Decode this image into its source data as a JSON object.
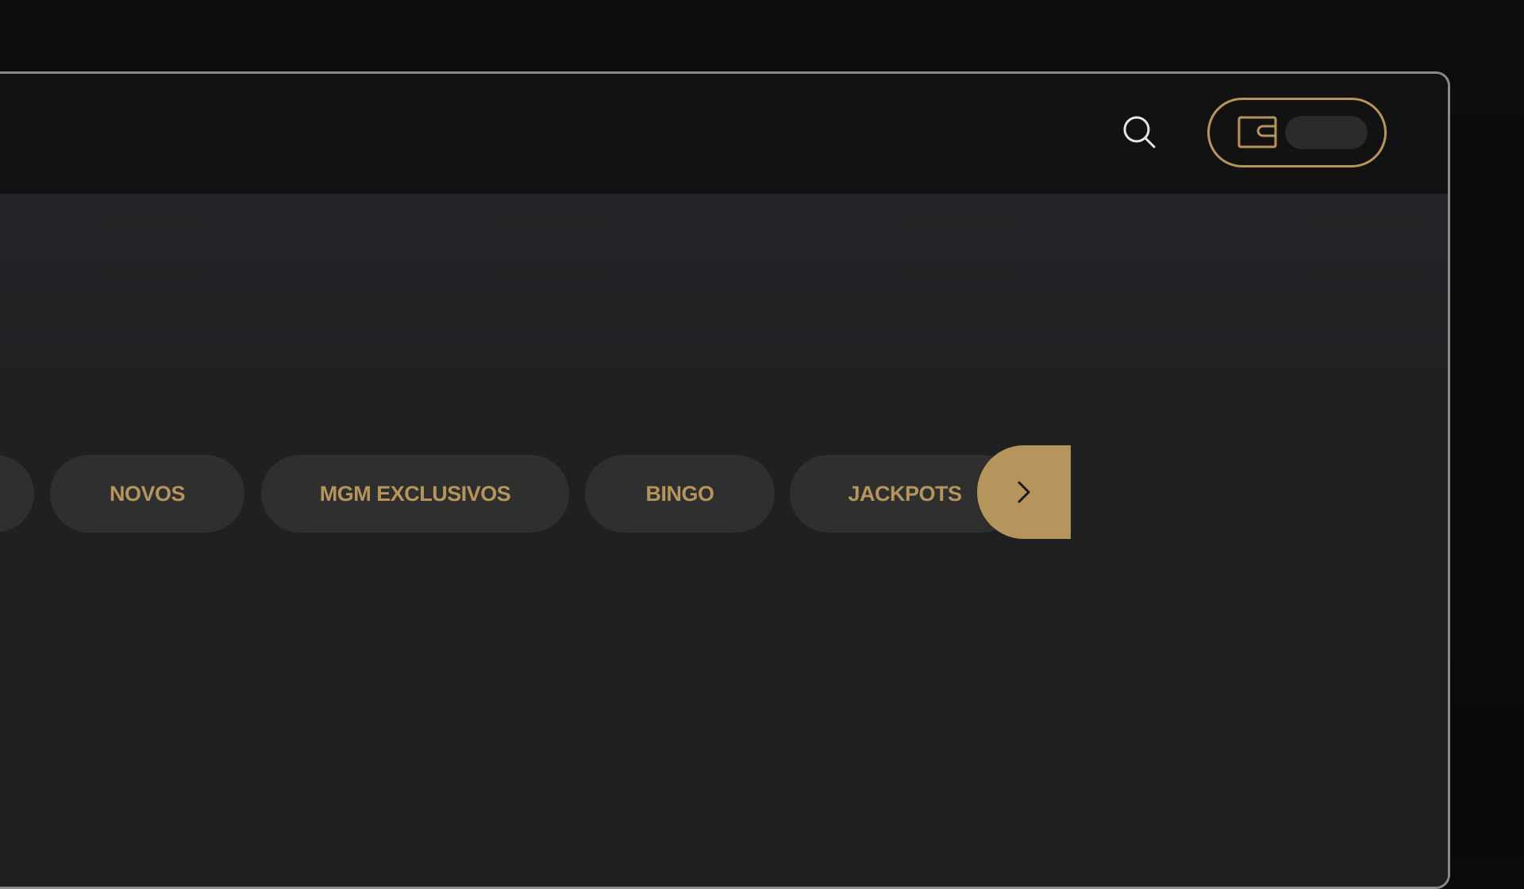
{
  "header": {
    "search_icon": "search-icon",
    "wallet_icon": "wallet-icon",
    "accent_color": "#b5955b"
  },
  "categories": {
    "items": [
      {
        "label": ""
      },
      {
        "label": "NOVOS"
      },
      {
        "label": "MGM EXCLUSIVOS"
      },
      {
        "label": "BINGO"
      },
      {
        "label": "JACKPOTS"
      }
    ],
    "next_icon": "chevron-right-icon"
  },
  "colors": {
    "accent": "#b5955b",
    "pill_background": "#2f2f30",
    "header_background": "#121213",
    "content_background": "#1e1f21"
  }
}
